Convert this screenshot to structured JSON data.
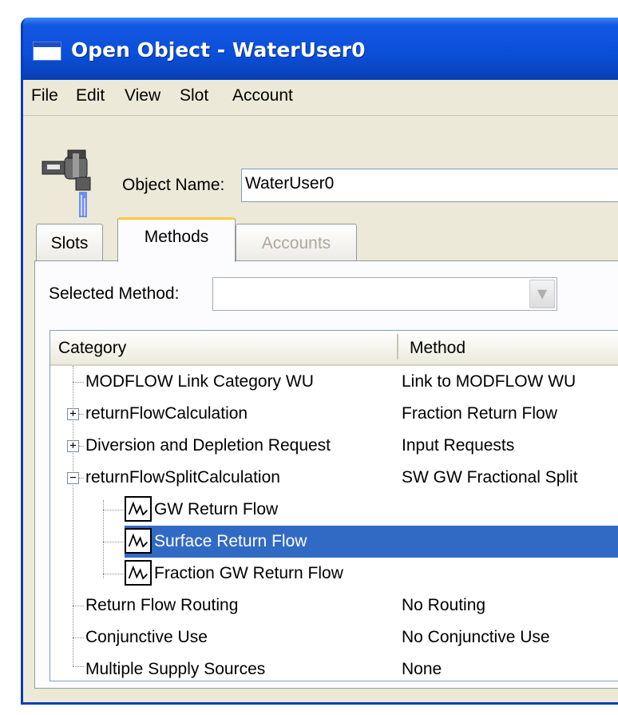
{
  "window": {
    "title": "Open Object - WaterUser0"
  },
  "menu": [
    "File",
    "Edit",
    "View",
    "Slot",
    "Account"
  ],
  "object": {
    "label": "Object Name:",
    "value": "WaterUser0",
    "icon": "water-faucet-icon"
  },
  "tabs": [
    {
      "label": "Slots",
      "state": "normal"
    },
    {
      "label": "Methods",
      "state": "active"
    },
    {
      "label": "Accounts",
      "state": "disabled"
    }
  ],
  "selected_method": {
    "label": "Selected Method:",
    "value": ""
  },
  "tree": {
    "columns": [
      "Category",
      "Method"
    ],
    "rows": [
      {
        "name": "MODFLOW Link Category WU",
        "method": "Link to MODFLOW WU",
        "expander": "none",
        "level": 0
      },
      {
        "name": "returnFlowCalculation",
        "method": "Fraction Return Flow",
        "expander": "+",
        "level": 0
      },
      {
        "name": "Diversion and Depletion Request",
        "method": "Input Requests",
        "expander": "+",
        "level": 0
      },
      {
        "name": "returnFlowSplitCalculation",
        "method": "SW GW Fractional Split",
        "expander": "−",
        "level": 0
      },
      {
        "name": "GW Return Flow",
        "method": "",
        "expander": "none",
        "level": 1,
        "icon": "series-slot-icon"
      },
      {
        "name": "Surface Return Flow",
        "method": "",
        "expander": "none",
        "level": 1,
        "icon": "series-slot-icon",
        "selected": true
      },
      {
        "name": "Fraction GW Return Flow",
        "method": "",
        "expander": "none",
        "level": 1,
        "icon": "series-slot-icon"
      },
      {
        "name": "Return Flow Routing",
        "method": "No Routing",
        "expander": "none",
        "level": 0
      },
      {
        "name": "Conjunctive Use",
        "method": "No Conjunctive Use",
        "expander": "none",
        "level": 0
      },
      {
        "name": "Multiple Supply Sources",
        "method": "None",
        "expander": "none",
        "level": 0
      }
    ]
  },
  "colors": {
    "titlebar": "#0a4fd8",
    "selection": "#316ac5",
    "active_tab_accent": "#ffc83c",
    "window_bg": "#ece9d8"
  }
}
